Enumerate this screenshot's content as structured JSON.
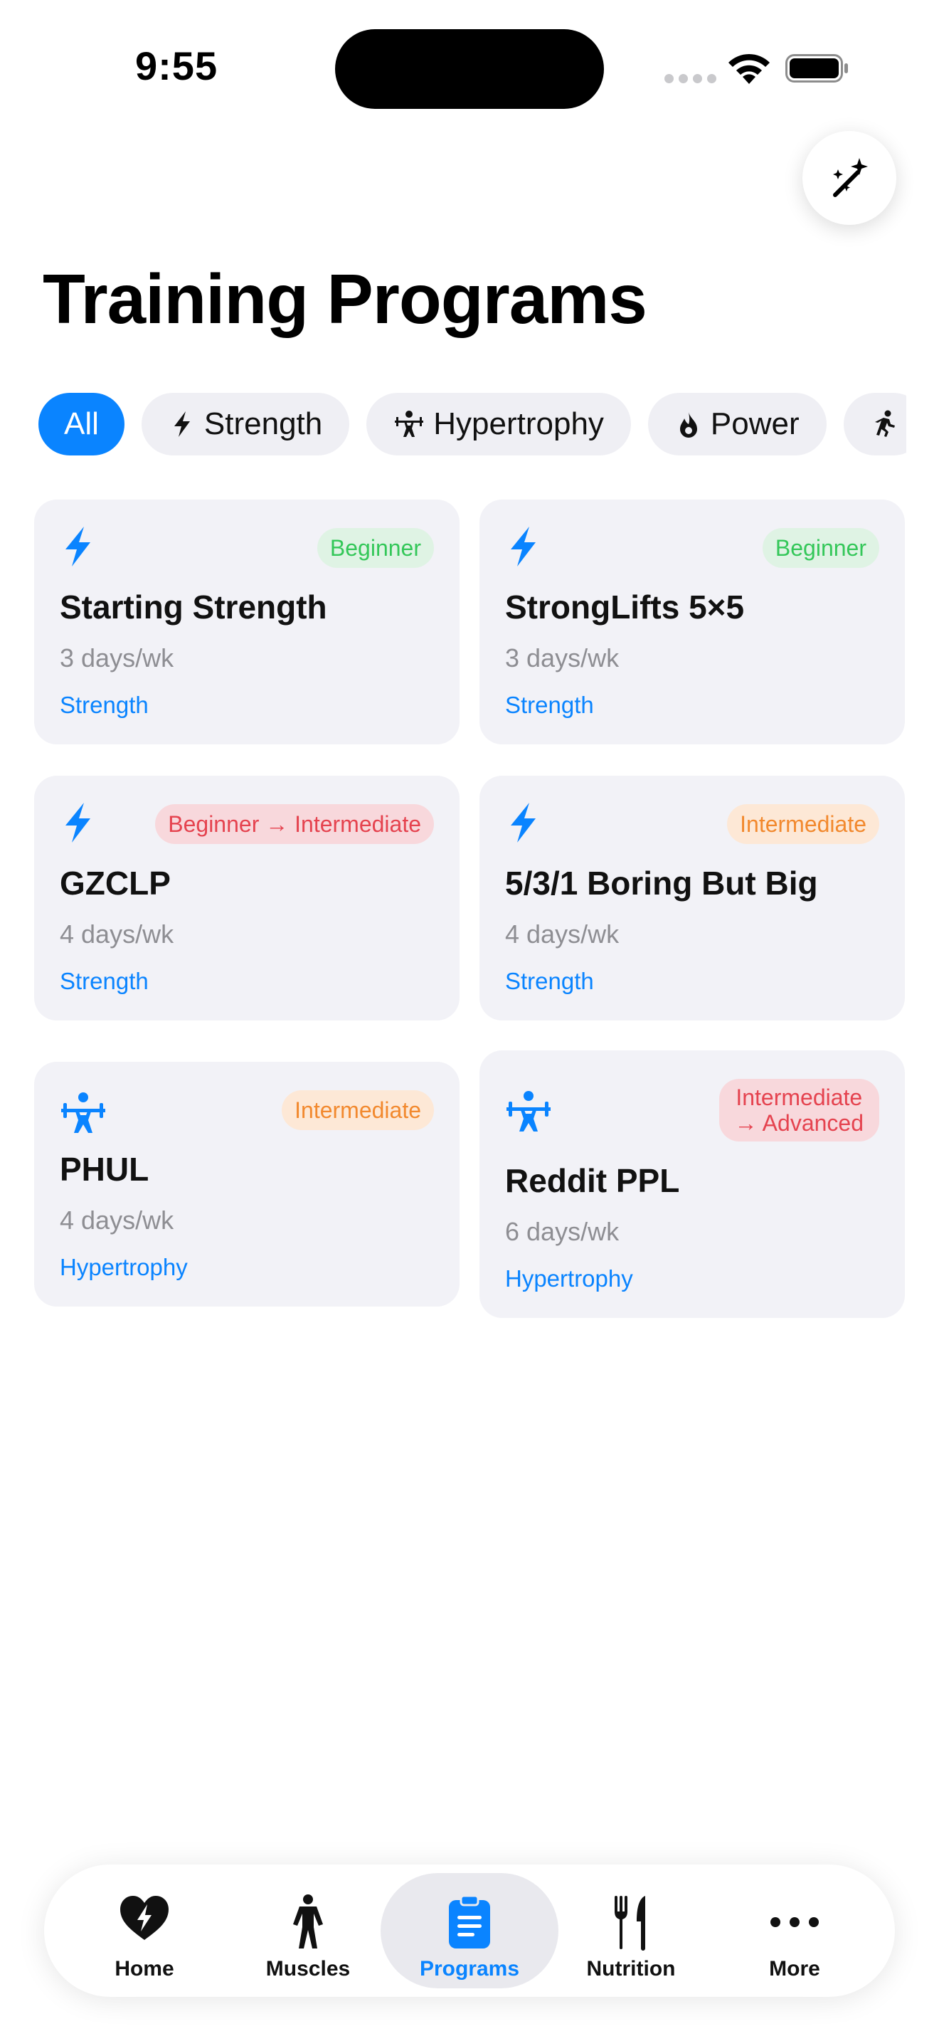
{
  "status_bar": {
    "time": "9:55"
  },
  "header": {
    "title": "Training Programs",
    "magic_icon": "magic-wand-sparkles-icon"
  },
  "filters": [
    {
      "label": "All",
      "icon": "",
      "active": true
    },
    {
      "label": "Strength",
      "icon": "bolt-icon",
      "active": false
    },
    {
      "label": "Hypertrophy",
      "icon": "weightlifter-icon",
      "active": false
    },
    {
      "label": "Power",
      "icon": "flame-icon",
      "active": false
    },
    {
      "label": "",
      "icon": "runner-icon",
      "active": false
    }
  ],
  "programs": [
    {
      "name": "Starting Strength",
      "level": "Beginner",
      "level_color": "green",
      "days": "3 days/wk",
      "category": "Strength",
      "icon": "bolt-icon"
    },
    {
      "name": "StrongLifts 5×5",
      "level": "Beginner",
      "level_color": "green",
      "days": "3 days/wk",
      "category": "Strength",
      "icon": "bolt-icon"
    },
    {
      "name": "GZCLP",
      "level": "Beginner → Intermediate",
      "level_color": "red",
      "days": "4 days/wk",
      "category": "Strength",
      "icon": "bolt-icon"
    },
    {
      "name": "5/3/1 Boring But Big",
      "level": "Intermediate",
      "level_color": "orange",
      "days": "4 days/wk",
      "category": "Strength",
      "icon": "bolt-icon"
    },
    {
      "name": "PHUL",
      "level": "Intermediate",
      "level_color": "orange",
      "days": "4 days/wk",
      "category": "Hypertrophy",
      "icon": "weightlifter-icon"
    },
    {
      "name": "Reddit PPL",
      "level_line1": "Intermediate",
      "level_line2": "→ Advanced",
      "level_color": "red",
      "days": "6 days/wk",
      "category": "Hypertrophy",
      "icon": "weightlifter-icon"
    }
  ],
  "tabbar": {
    "items": [
      {
        "label": "Home",
        "icon": "heart-bolt-icon"
      },
      {
        "label": "Muscles",
        "icon": "figure-icon"
      },
      {
        "label": "Programs",
        "icon": "clipboard-icon",
        "active": true
      },
      {
        "label": "Nutrition",
        "icon": "fork-knife-icon"
      },
      {
        "label": "More",
        "icon": "ellipsis-icon"
      }
    ]
  },
  "colors": {
    "accent": "#0a84ff",
    "card_bg": "#f2f2f7",
    "green": "#34c759",
    "orange": "#f2892e",
    "red": "#e5434f"
  }
}
